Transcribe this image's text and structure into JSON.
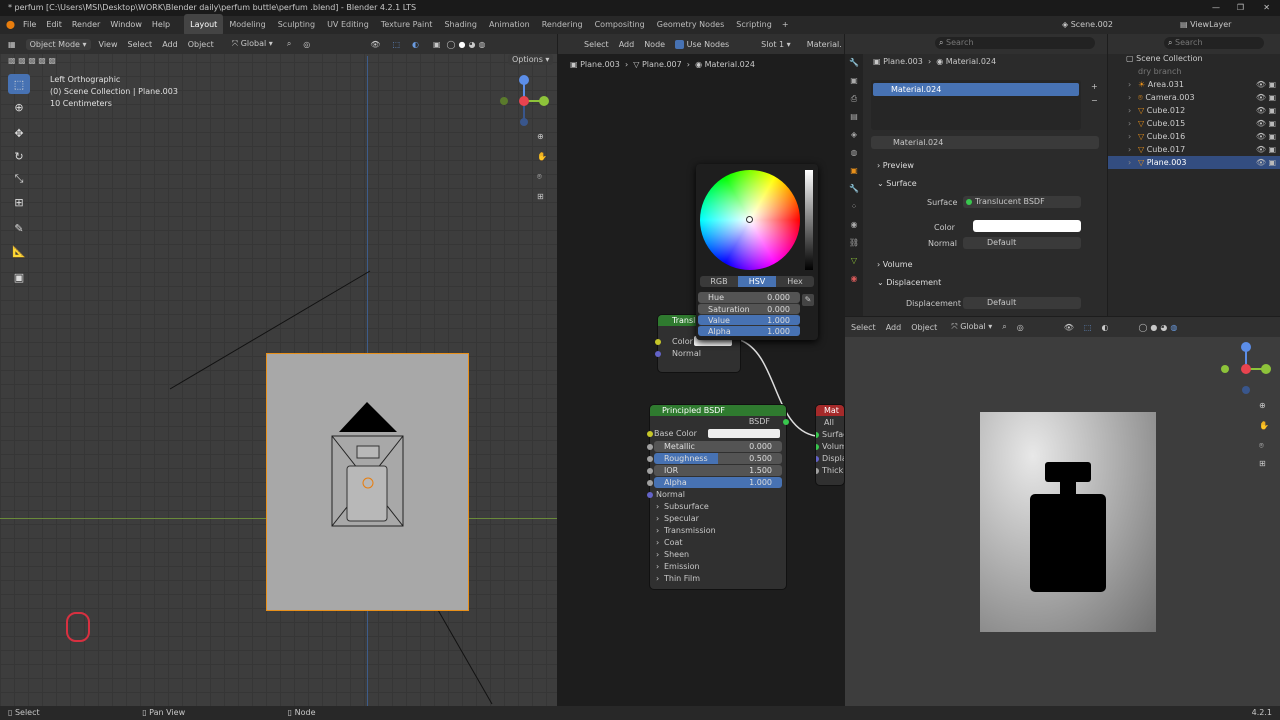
{
  "title_bar": {
    "text": "* perfum [C:\\Users\\MSI\\Desktop\\WORK\\Blender daily\\perfum buttle\\perfum .blend] - Blender 4.2.1 LTS"
  },
  "menu": [
    "File",
    "Edit",
    "Render",
    "Window",
    "Help"
  ],
  "workspaces": [
    "Layout",
    "Modeling",
    "Sculpting",
    "UV Editing",
    "Texture Paint",
    "Shading",
    "Animation",
    "Rendering",
    "Compositing",
    "Geometry Nodes",
    "Scripting"
  ],
  "active_workspace": "Layout",
  "scene": "Scene.002",
  "view_layer": "ViewLayer",
  "viewport": {
    "mode": "Object Mode",
    "menu": [
      "View",
      "Select",
      "Add",
      "Object"
    ],
    "transform": "Global",
    "options": "Options",
    "info": [
      "Left Orthographic",
      "(0) Scene Collection | Plane.003",
      "10 Centimeters"
    ],
    "axis": {
      "x": "X",
      "y": "Y",
      "z": "Z"
    }
  },
  "node_editor": {
    "menu": [
      "Select",
      "Add",
      "Node"
    ],
    "use_nodes": "Use Nodes",
    "slot": "Slot 1",
    "material": "Material.",
    "breadcrumb": [
      "Plane.003",
      "Plane.007",
      "Material.024"
    ],
    "color_picker": {
      "tabs": [
        "RGB",
        "HSV",
        "Hex"
      ],
      "active": "HSV",
      "fields": [
        {
          "label": "Hue",
          "value": "0.000"
        },
        {
          "label": "Saturation",
          "value": "0.000"
        },
        {
          "label": "Value",
          "value": "1.000"
        },
        {
          "label": "Alpha",
          "value": "1.000"
        }
      ]
    },
    "translucent_node": {
      "title": "Translu",
      "inputs": [
        "Color",
        "Normal"
      ]
    },
    "principled_node": {
      "title": "Principled BSDF",
      "output": "BSDF",
      "base_color": "Base Color",
      "metallic": {
        "label": "Metallic",
        "value": "0.000"
      },
      "roughness": {
        "label": "Roughness",
        "value": "0.500"
      },
      "ior": {
        "label": "IOR",
        "value": "1.500"
      },
      "alpha": {
        "label": "Alpha",
        "value": "1.000"
      },
      "normal": "Normal",
      "panels": [
        "Subsurface",
        "Specular",
        "Transmission",
        "Coat",
        "Sheen",
        "Emission",
        "Thin Film"
      ]
    },
    "output_node": {
      "title": "Mat",
      "target": "All",
      "inputs": [
        "Surface",
        "Volume",
        "Displace",
        "Thickn"
      ]
    }
  },
  "properties": {
    "search": "Search",
    "object": "Plane.003",
    "material": "Material.024",
    "slot": "Material.024",
    "material_field": "Material.024",
    "sections": {
      "preview": "Preview",
      "surface": "Surface",
      "volume": "Volume",
      "displacement": "Displacement"
    },
    "surface_label": "Surface",
    "surface_value": "Translucent BSDF",
    "color_label": "Color",
    "normal_label": "Normal",
    "normal_value": "Default",
    "disp_label": "Displacement",
    "disp_value": "Default"
  },
  "outliner": {
    "search": "Search",
    "root": "Scene Collection",
    "items": [
      "dry branch",
      "Area.031",
      "Camera.003",
      "Cube.012",
      "Cube.015",
      "Cube.016",
      "Cube.017",
      "Plane.003"
    ]
  },
  "render_view": {
    "menu": [
      "Select",
      "Add",
      "Object"
    ],
    "transform": "Global",
    "axis": {
      "x": "X",
      "y": "Y",
      "z": "Z"
    }
  },
  "status": {
    "select": "Select",
    "pan": "Pan View",
    "node": "Node",
    "version": "4.2.1"
  }
}
